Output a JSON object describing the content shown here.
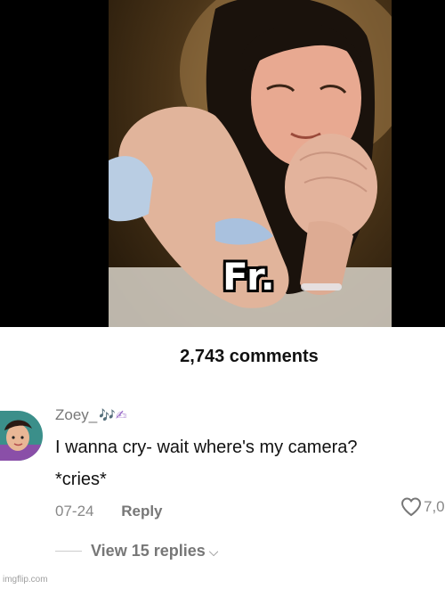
{
  "post": {
    "overlay_caption": "Fr.",
    "comments_count_label": "2,743 comments"
  },
  "comment": {
    "username": "Zoey_",
    "username_decoration": "🎶✍",
    "text_line1": "I wanna cry- wait where's my camera?",
    "text_line2": "*cries*",
    "date": "07-24",
    "reply_label": "Reply",
    "like_count": "7,0",
    "view_replies_label": "View 15 replies"
  },
  "watermark": "imgflip.com",
  "icons": {
    "like": "heart-outline-icon",
    "expand": "chevron-down-icon",
    "avatar": "user-avatar-icon"
  },
  "colors": {
    "background": "#ffffff",
    "video_letterbox": "#000000",
    "secondary_text": "#888888",
    "primary_text": "#111111"
  }
}
